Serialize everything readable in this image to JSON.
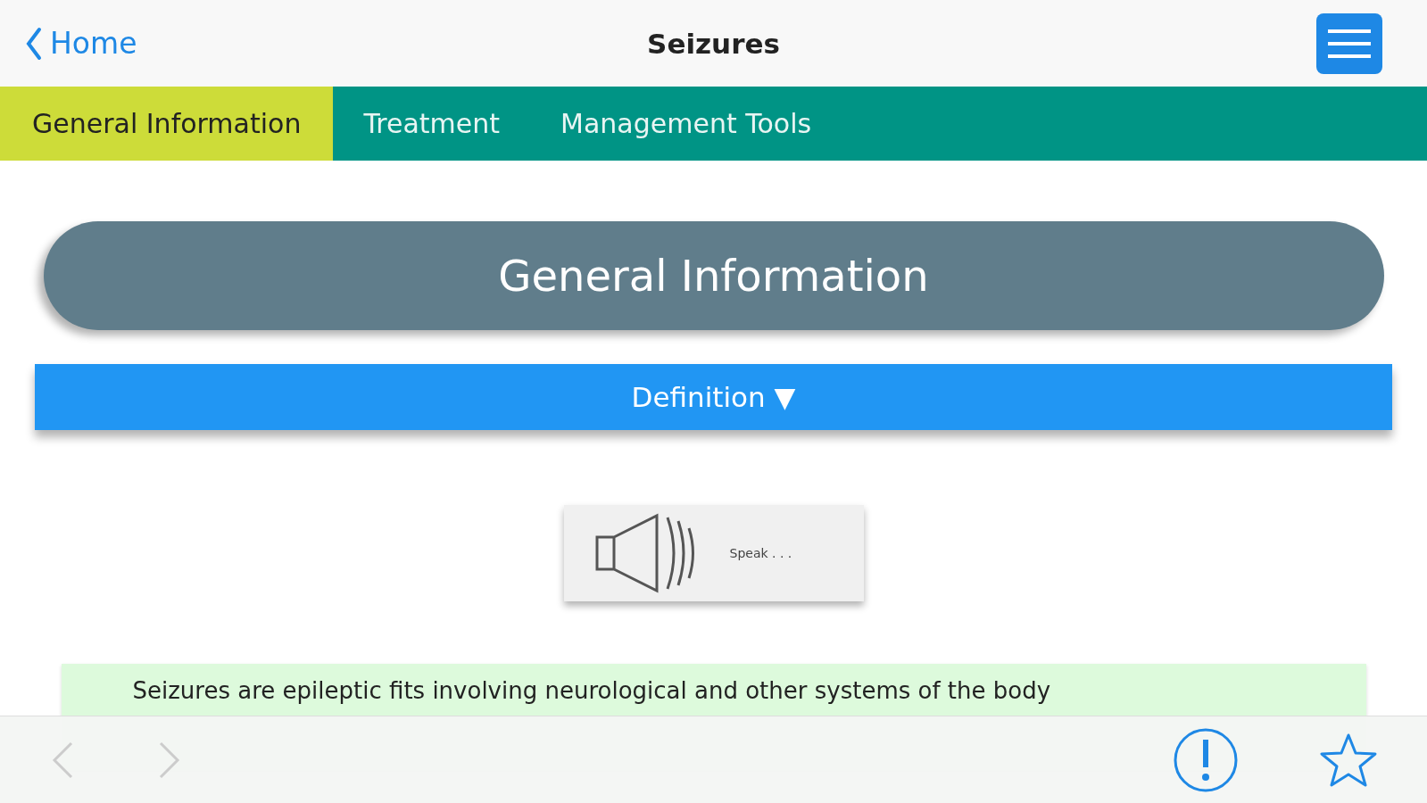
{
  "nav": {
    "back": "Home",
    "title": "Seizures"
  },
  "tabs": [
    {
      "label": "General Information",
      "selected": true
    },
    {
      "label": "Treatment",
      "selected": false
    },
    {
      "label": "Management Tools",
      "selected": false
    }
  ],
  "header": "General Information",
  "section": {
    "label": "Definition",
    "arrow": "▼"
  },
  "speak": "Speak . . .",
  "definition": "Seizures are epileptic fits involving neurological and other systems of the body",
  "toolbar": {
    "back_disabled": true,
    "forward_disabled": true
  }
}
